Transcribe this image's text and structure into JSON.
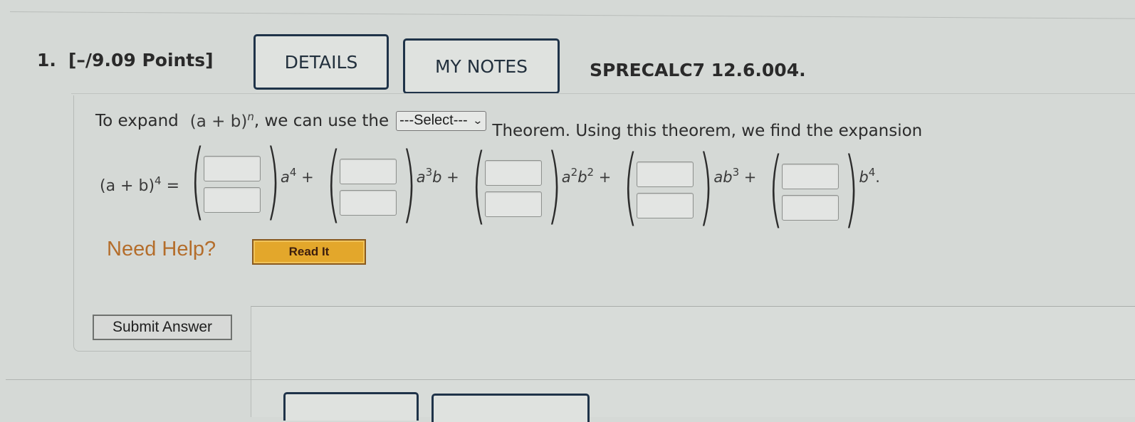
{
  "question": {
    "number": "1.",
    "points": "[–/9.09 Points]",
    "details_label": "DETAILS",
    "notes_label": "MY NOTES",
    "code": "SPRECALC7 12.6.004."
  },
  "prompt": {
    "text_before": "To expand",
    "math_base": "(a + b)",
    "math_exp": "n",
    "text_after_math": ", we can use the",
    "select": {
      "selected": "---Select---",
      "icon": "chevron-down-icon"
    },
    "text_after_select": "Theorem. Using this theorem, we find the expansion"
  },
  "expansion": {
    "lhs_base": "(a + b)",
    "lhs_exp": "4",
    "equals": "=",
    "terms": [
      {
        "var1": "a",
        "exp1": "4",
        "var2": "",
        "exp2": "",
        "suffix": " +",
        "numerator": "",
        "denominator": ""
      },
      {
        "var1": "a",
        "exp1": "3",
        "var2": "b",
        "exp2": "",
        "suffix": " +",
        "numerator": "",
        "denominator": ""
      },
      {
        "var1": "a",
        "exp1": "2",
        "var2": "b",
        "exp2": "2",
        "suffix": " +",
        "numerator": "",
        "denominator": ""
      },
      {
        "var1": "ab",
        "exp1": "",
        "var2": "",
        "exp2": "3",
        "suffix": " +",
        "numerator": "",
        "denominator": ""
      },
      {
        "var1": "b",
        "exp1": "4",
        "var2": "",
        "exp2": "",
        "suffix": ".",
        "numerator": "",
        "denominator": ""
      }
    ]
  },
  "help": {
    "label": "Need Help?",
    "read_it_label": "Read It"
  },
  "submit_label": "Submit Answer",
  "colors": {
    "accent_navy": "#1f3349",
    "help_orange": "#b46d2b",
    "read_it_gold": "#e3a72b"
  }
}
